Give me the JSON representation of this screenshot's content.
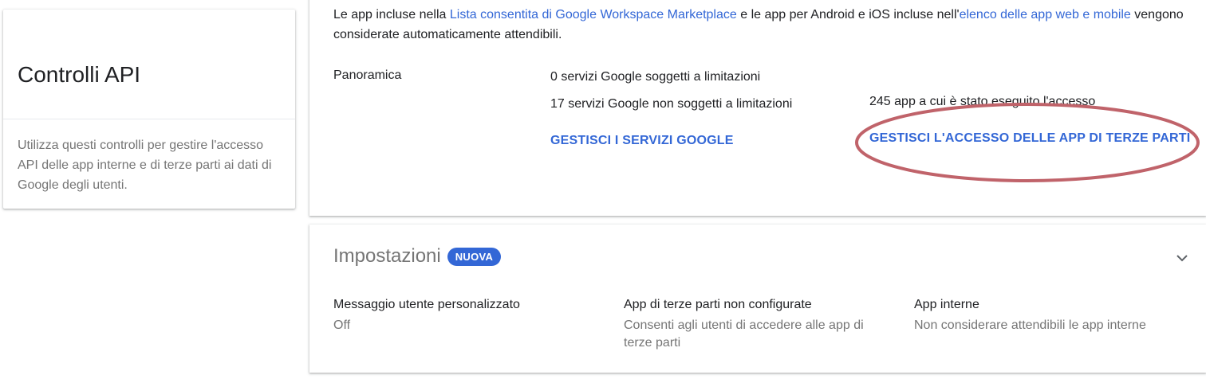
{
  "left_card": {
    "title": "Controlli API",
    "description": "Utilizza questi controlli per gestire l'accesso API delle app interne e di terze parti ai dati di Google degli utenti."
  },
  "intro": {
    "part1": "Le app incluse nella ",
    "link1": "Lista consentita di Google Workspace Marketplace",
    "part2": " e le app per Android e iOS incluse nell'",
    "link2": "elenco delle app web e mobile",
    "part3": " vengono considerate automaticamente attendibili."
  },
  "overview": {
    "label": "Panoramica",
    "restricted_services": "0 servizi Google soggetti a limitazioni",
    "unrestricted_services": "17 servizi Google non soggetti a limitazioni",
    "apps_accessed": "245 app a cui è stato eseguito l'accesso",
    "manage_google_link": "GESTISCI I SERVIZI GOOGLE",
    "manage_third_party_link": "GESTISCI L'ACCESSO DELLE APP DI TERZE PARTI"
  },
  "settings": {
    "title": "Impostazioni",
    "badge": "NUOVA",
    "items": [
      {
        "name": "Messaggio utente personalizzato",
        "value": "Off"
      },
      {
        "name": "App di terze parti non configurate",
        "value": "Consenti agli utenti di accedere alle app di terze parti"
      },
      {
        "name": "App interne",
        "value": "Non considerare attendibili le app interne"
      }
    ]
  },
  "icons": {
    "chevron": "chevron-down-icon"
  },
  "colors": {
    "link": "#3367d6",
    "annotation": "#c0636a",
    "muted_text": "#757575"
  }
}
